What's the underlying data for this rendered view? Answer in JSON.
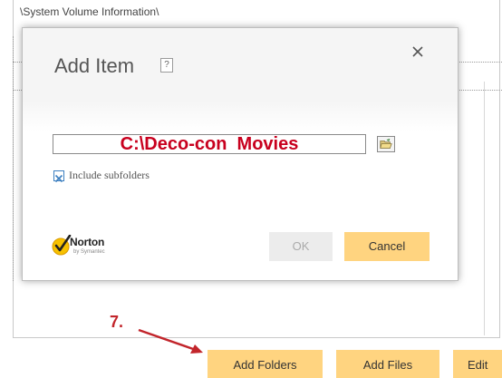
{
  "background": {
    "path_text": "\\System Volume Information\\"
  },
  "dialog": {
    "title": "Add Item",
    "help_label": "?",
    "folder_path": "C:\\Deco-con  Movies",
    "include_subfolders_checked": true,
    "include_subfolders_label": "Include subfolders",
    "ok_label": "OK",
    "cancel_label": "Cancel",
    "brand": {
      "name": "Norton",
      "tagline": "by Symantec"
    }
  },
  "annotation": {
    "step": "7."
  },
  "toolbar": {
    "add_folders_label": "Add Folders",
    "add_files_label": "Add Files",
    "edit_label": "Edit"
  },
  "colors": {
    "accent_button": "#ffd480",
    "disabled_button": "#ececec",
    "path_text": "#c8001e",
    "annotation": "#c2252b",
    "checkbox_blue": "#3c7fc0"
  },
  "icons": {
    "help": "help-icon",
    "close": "close-icon",
    "browse": "folder-open-icon",
    "checkbox": "checkbox-checked-icon",
    "brand": "norton-checkmark-icon",
    "annotation_arrow": "arrow-icon"
  }
}
